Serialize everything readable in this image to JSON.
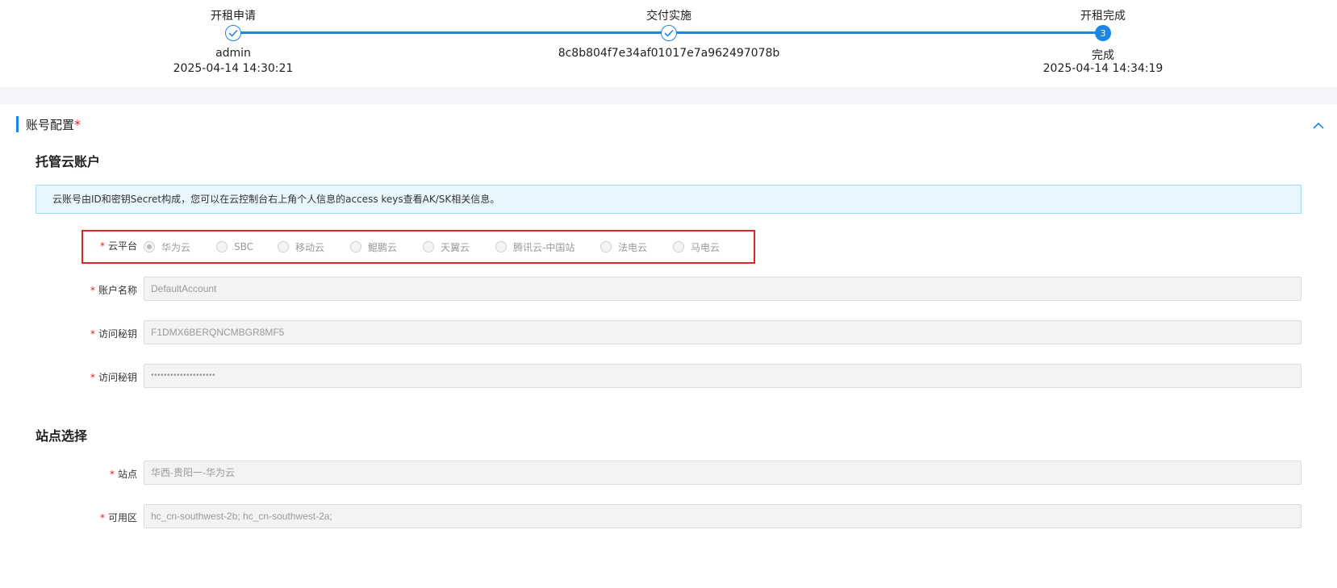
{
  "steps": [
    {
      "title": "开租申请",
      "line1": "admin",
      "line2": "2025-04-14 14:30:21",
      "state": "done"
    },
    {
      "title": "交付实施",
      "line1": "8c8b804f7e34af01017e7a962497078b",
      "line2": "",
      "state": "done"
    },
    {
      "title": "开租完成",
      "line1": "完成",
      "line2": "2025-04-14 14:34:19",
      "state": "current",
      "number": "3"
    }
  ],
  "section": {
    "title": "账号配置",
    "required_mark": "*"
  },
  "hosted_account": {
    "title": "托管云账户",
    "info": "云账号由ID和密钥Secret构成，您可以在云控制台右上角个人信息的access keys查看AK/SK相关信息。",
    "cloud_platform": {
      "label": "云平台",
      "options": [
        "华为云",
        "SBC",
        "移动云",
        "鲲鹏云",
        "天翼云",
        "腾讯云-中国站",
        "法电云",
        "马电云"
      ],
      "selected": "华为云"
    },
    "account_name": {
      "label": "账户名称",
      "value": "DefaultAccount"
    },
    "access_key": {
      "label": "访问秘钥",
      "value": "F1DMX6BERQNCMBGR8MF5"
    },
    "secret_key": {
      "label": "访问秘钥",
      "value": "••••••••••••••••••••"
    }
  },
  "site_selection": {
    "title": "站点选择",
    "site": {
      "label": "站点",
      "value": "华西-贵阳一-华为云"
    },
    "zone": {
      "label": "可用区",
      "value": "hc_cn-southwest-2b; hc_cn-southwest-2a;"
    }
  },
  "colors": {
    "accent": "#1b86e6",
    "required": "#e02020",
    "highlight": "#e02525"
  },
  "required_mark": "*"
}
